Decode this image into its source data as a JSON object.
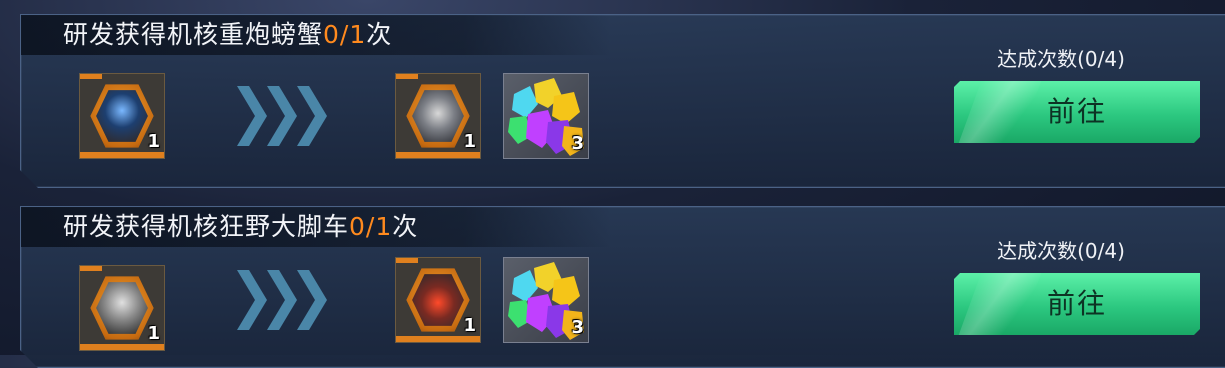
{
  "tasks": [
    {
      "title_prefix": "研发获得机核重炮螃蟹",
      "title_progress": "0/1",
      "title_suffix": "次",
      "input_item": {
        "icon": "robot-core-blue-icon",
        "count": "1"
      },
      "reward_items": [
        {
          "icon": "heavy-cannon-crab-core-icon",
          "count": "1"
        },
        {
          "icon": "crystal-gems-icon",
          "count": "3"
        }
      ],
      "goal_text": "达成次数(0/4)",
      "go_label": "前往"
    },
    {
      "title_prefix": "研发获得机核狂野大脚车",
      "title_progress": "0/1",
      "title_suffix": "次",
      "input_item": {
        "icon": "robot-core-gray-icon",
        "count": "1"
      },
      "reward_items": [
        {
          "icon": "wild-bigfoot-core-icon",
          "count": "1"
        },
        {
          "icon": "crystal-gems-icon",
          "count": "3"
        }
      ],
      "goal_text": "达成次数(0/4)",
      "go_label": "前往"
    }
  ],
  "colors": {
    "progress": "#ff8a1e",
    "button": "#2cc880",
    "item_frame": "#e0801e"
  }
}
